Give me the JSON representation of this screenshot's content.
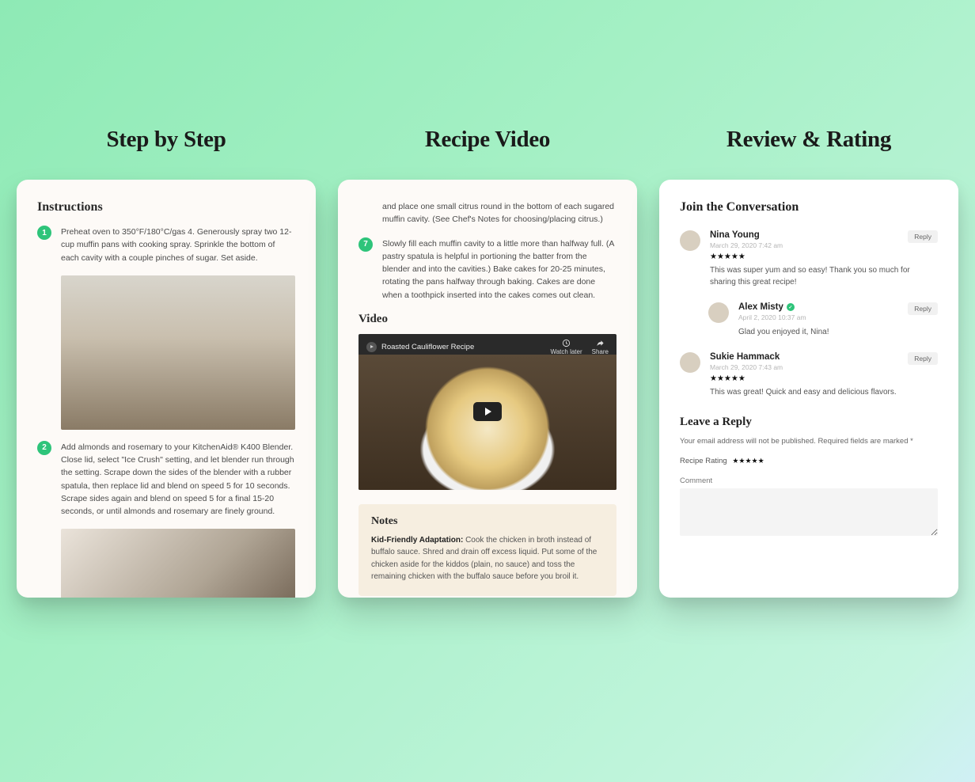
{
  "columns": {
    "step": {
      "title": "Step by Step"
    },
    "video": {
      "title": "Recipe Video"
    },
    "review": {
      "title": "Review & Rating"
    }
  },
  "card1": {
    "heading": "Instructions",
    "steps": [
      {
        "num": "1",
        "text": "Preheat oven to 350°F/180°C/gas 4. Generously spray two 12-cup muffin pans with cooking spray. Sprinkle the bottom of each cavity with a couple pinches of sugar. Set aside."
      },
      {
        "num": "2",
        "text": "Add almonds and rosemary to your KitchenAid® K400 Blender. Close lid, select \"Ice Crush\" setting, and let blender run through the setting. Scrape down the sides of the blender with a rubber spatula, then replace lid and blend on speed 5 for 10 seconds. Scrape sides again and blend on speed 5 for a final 15-20 seconds, or until almonds and rosemary are finely ground."
      }
    ]
  },
  "card2": {
    "pre_text": "and place one small citrus round in the bottom of each sugared muffin cavity. (See Chef's Notes for choosing/placing citrus.)",
    "step7": {
      "num": "7",
      "text": "Slowly fill each muffin cavity to a little more than halfway full. (A pastry spatula is helpful in portioning the batter from the blender and into the cavities.) Bake cakes for 20-25 minutes, rotating the pans halfway through baking. Cakes are done when a toothpick inserted into the cakes comes out clean."
    },
    "video_heading": "Video",
    "video_title": "Roasted Cauliflower Recipe",
    "watch_later": "Watch later",
    "share": "Share",
    "notes_heading": "Notes",
    "notes_bold": "Kid-Friendly Adaptation:",
    "notes_text": " Cook the chicken in broth instead of buffalo sauce. Shred and drain off excess liquid. Put some of the chicken aside for the kiddos (plain, no sauce) and toss the remaining chicken with the buffalo sauce before you broil it."
  },
  "card3": {
    "heading": "Join the Conversation",
    "reply_label": "Reply",
    "comments": [
      {
        "name": "Nina Young",
        "date": "March 29, 2020 7:42 am",
        "stars": "★★★★★",
        "text": "This was super yum and so easy! Thank you so much for sharing this great recipe!",
        "badge": false
      },
      {
        "name": "Alex Misty",
        "date": "April 2, 2020 10:37 am",
        "text": "Glad you enjoyed it, Nina!",
        "badge": true,
        "nested": true
      },
      {
        "name": "Sukie Hammack",
        "date": "March 29, 2020 7:43 am",
        "stars": "★★★★★",
        "text": "This was great! Quick and easy and delicious flavors.",
        "badge": false
      }
    ],
    "leave_reply": "Leave a Reply",
    "reply_note": "Your email address will not be published. Required fields are marked *",
    "recipe_rating_label": "Recipe Rating",
    "recipe_rating_stars": "★★★★★",
    "comment_label": "Comment"
  }
}
